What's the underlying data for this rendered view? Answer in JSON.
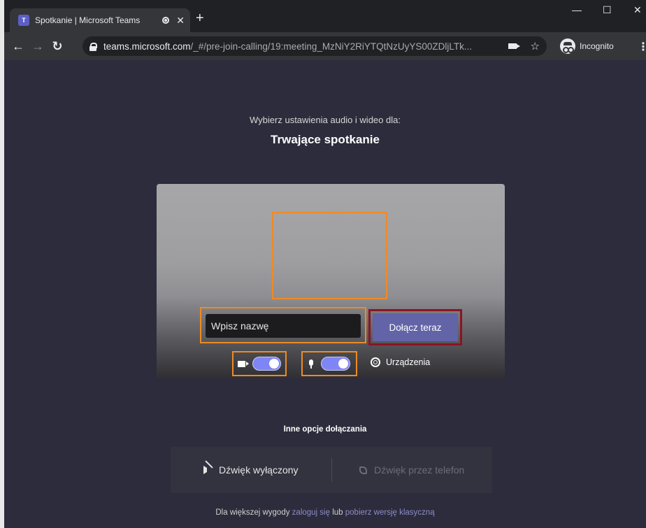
{
  "browser": {
    "tab_title": "Spotkanie | Microsoft Teams",
    "tab_favicon": "teams-icon",
    "new_tab_label": "+",
    "url_host": "teams.microsoft.com",
    "url_path": "/_#/pre-join-calling/19:meeting_MzNiY2RiYTQtNzUyYS00ZDljLTk...",
    "incognito_label": "Incognito"
  },
  "prejoin": {
    "subtitle": "Wybierz ustawienia audio i wideo dla:",
    "title": "Trwające spotkanie",
    "name_placeholder": "Wpisz nazwę",
    "join_label": "Dołącz teraz",
    "camera_on": true,
    "mic_on": true,
    "devices_label": "Urządzenia"
  },
  "other_options": {
    "title": "Inne opcje dołączania",
    "audio_off_label": "Dźwięk wyłączony",
    "phone_audio_label": "Dźwięk przez telefon"
  },
  "footer": {
    "prefix": "Dla większej wygody ",
    "login_link": "zaloguj się",
    "middle": " lub ",
    "download_link": "pobierz wersję klasyczną"
  },
  "colors": {
    "accent": "#6264a7",
    "highlight_orange": "#f08a24",
    "highlight_red": "#8b1423",
    "background": "#2d2c3c"
  }
}
